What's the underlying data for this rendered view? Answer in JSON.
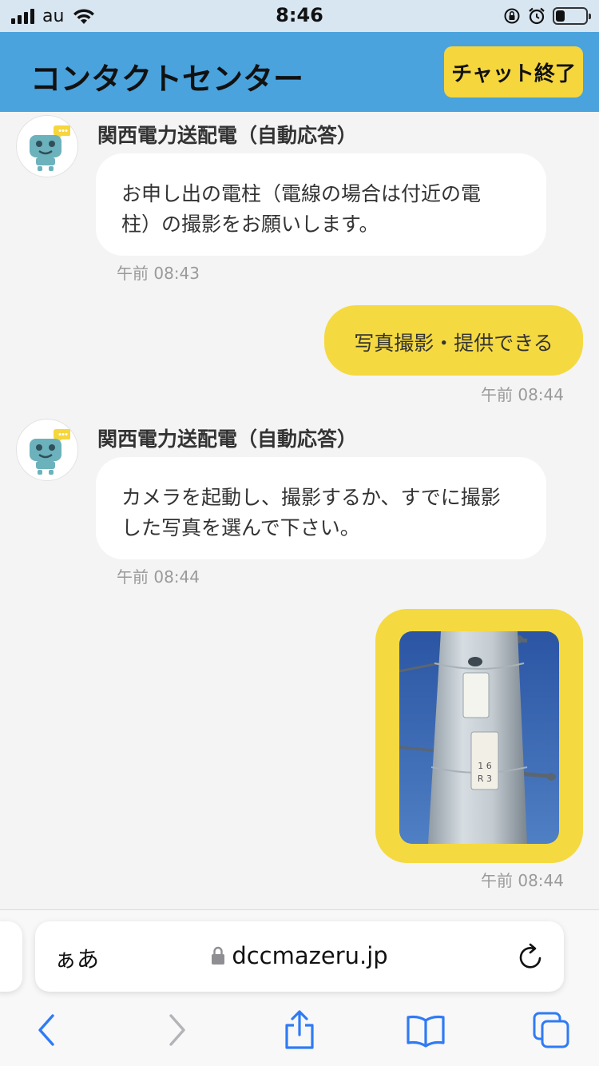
{
  "status_bar": {
    "carrier": "au",
    "time": "8:46"
  },
  "header": {
    "title": "コンタクトセンター",
    "end_chat_label": "チャット終了"
  },
  "messages": [
    {
      "sender": "関西電力送配電（自動応答）",
      "line1": "お申し出の電柱（電線の場合は付近の電",
      "line2": "柱）の撮影をお願いします。",
      "time": "午前 08:43"
    },
    {
      "text": "写真撮影・提供できる",
      "time": "午前 08:44"
    },
    {
      "sender": "関西電力送配電（自動応答）",
      "line1": "カメラを起動し、撮影するか、すでに撮影",
      "line2": "した写真を選んで下さい。",
      "time": "午前 08:44"
    },
    {
      "time": "午前 08:44"
    }
  ],
  "safari": {
    "aa_label": "ぁあ",
    "url": "dccmazeru.jp"
  },
  "icons": {
    "avatar": "robot-avatar-icon",
    "lock": "lock-icon",
    "reload": "reload-icon",
    "back": "back-icon",
    "forward": "forward-icon",
    "share": "share-icon",
    "bookmarks": "bookmarks-icon",
    "tabs": "tabs-icon"
  },
  "colors": {
    "header": "#4aa3dc",
    "accent": "#f5d940",
    "ios_blue": "#2f7bf5"
  }
}
